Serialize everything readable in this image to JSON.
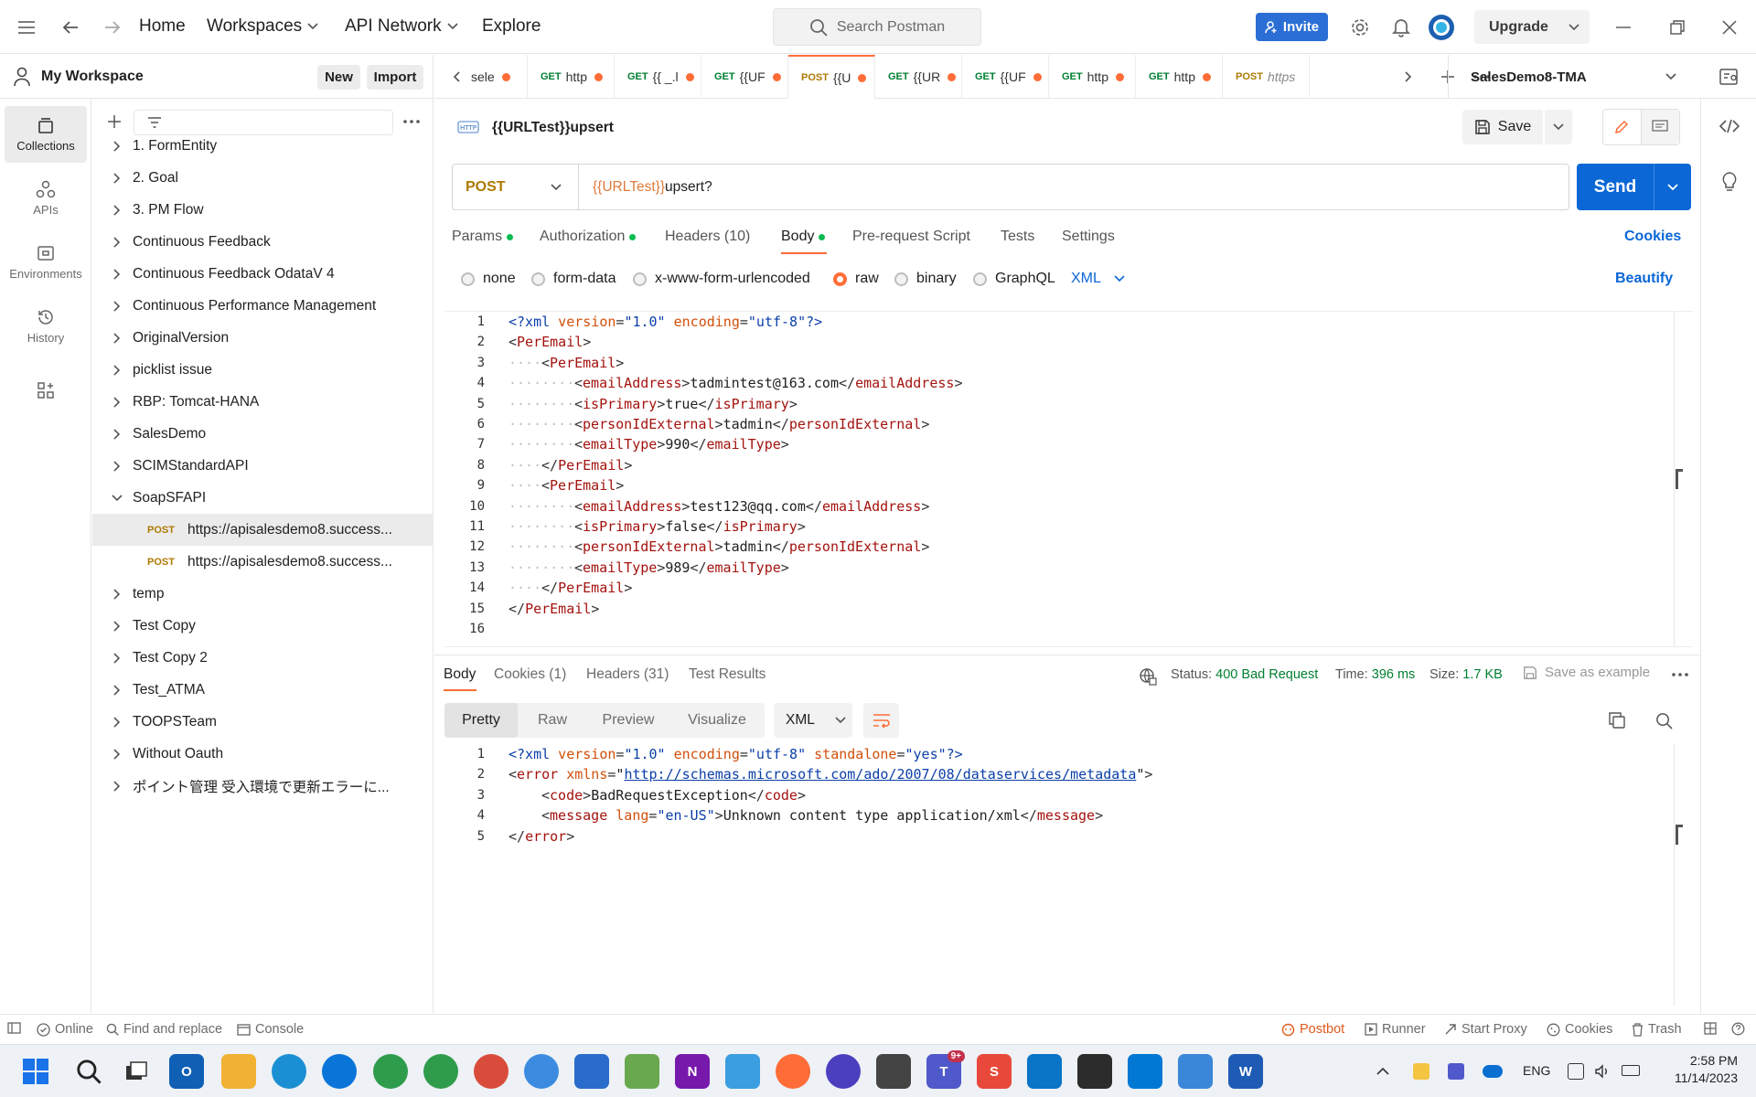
{
  "nav": {
    "home": "Home",
    "workspaces": "Workspaces",
    "api_network": "API Network",
    "explore": "Explore",
    "search_placeholder": "Search Postman",
    "invite": "Invite",
    "upgrade": "Upgrade"
  },
  "workspace": {
    "title": "My Workspace",
    "new_label": "New",
    "import_label": "Import"
  },
  "rail": [
    {
      "label": "Collections",
      "icon": "collections-icon"
    },
    {
      "label": "APIs",
      "icon": "apis-icon"
    },
    {
      "label": "Environments",
      "icon": "environments-icon"
    },
    {
      "label": "History",
      "icon": "history-icon"
    }
  ],
  "collections": [
    {
      "label": "1. FormEntity"
    },
    {
      "label": "2. Goal"
    },
    {
      "label": "3. PM Flow"
    },
    {
      "label": "Continuous Feedback"
    },
    {
      "label": "Continuous Feedback OdataV 4"
    },
    {
      "label": "Continuous Performance Management"
    },
    {
      "label": "OriginalVersion"
    },
    {
      "label": "picklist issue"
    },
    {
      "label": "RBP: Tomcat-HANA"
    },
    {
      "label": "SalesDemo"
    },
    {
      "label": "SCIMStandardAPI"
    },
    {
      "label": "SoapSFAPI",
      "expanded": true
    },
    {
      "label": "https://apisalesdemo8.success...",
      "method": "POST",
      "child": true,
      "selected": true
    },
    {
      "label": "https://apisalesdemo8.success...",
      "method": "POST",
      "child": true
    },
    {
      "label": "temp"
    },
    {
      "label": "Test Copy"
    },
    {
      "label": "Test Copy 2"
    },
    {
      "label": "Test_ATMA"
    },
    {
      "label": "TOOPSTeam"
    },
    {
      "label": "Without Oauth"
    },
    {
      "label": "ポイント管理 受入環境で更新エラーに..."
    }
  ],
  "tabs": [
    {
      "method": "",
      "label": "sele"
    },
    {
      "method": "GET",
      "label": "http"
    },
    {
      "method": "GET",
      "label": "{{ _.l"
    },
    {
      "method": "GET",
      "label": "{{UF"
    },
    {
      "method": "POST",
      "label": "{{U",
      "active": true
    },
    {
      "method": "GET",
      "label": "{{UR"
    },
    {
      "method": "GET",
      "label": "{{UF"
    },
    {
      "method": "GET",
      "label": "http"
    },
    {
      "method": "GET",
      "label": "http"
    },
    {
      "method": "POST",
      "label": "https",
      "italic": true
    }
  ],
  "environment": "SalesDemo8-TMA",
  "request": {
    "badge": "HTTP",
    "title": "{{URLTest}}upsert",
    "save_label": "Save",
    "method": "POST",
    "url_var": "{{URLTest}}",
    "url_rest": "upsert?",
    "send_label": "Send",
    "tabs": {
      "params": "Params",
      "authorization": "Authorization",
      "headers": "Headers (10)",
      "body": "Body",
      "prerequest": "Pre-request Script",
      "tests": "Tests",
      "settings": "Settings"
    },
    "cookies_label": "Cookies",
    "body_modes": {
      "none": "none",
      "form_data": "form-data",
      "urlencoded": "x-www-form-urlencoded",
      "raw": "raw",
      "binary": "binary",
      "graphql": "GraphQL"
    },
    "language": "XML",
    "beautify": "Beautify",
    "body_lines": [
      "<?xml version=\"1.0\" encoding=\"utf-8\"?>",
      "<PerEmail>",
      "<PerEmail>",
      "<emailAddress>tadmintest@163.com</emailAddress>",
      "<isPrimary>true</isPrimary>",
      "<personIdExternal>tadmin</personIdExternal>",
      "<emailType>990</emailType>",
      "</PerEmail>",
      "<PerEmail>",
      "<emailAddress>test123@qq.com</emailAddress>",
      "<isPrimary>false</isPrimary>",
      "<personIdExternal>tadmin</personIdExternal>",
      "<emailType>989</emailType>",
      "</PerEmail>",
      "</PerEmail>",
      ""
    ]
  },
  "response": {
    "tabs": {
      "body": "Body",
      "cookies": "Cookies (1)",
      "headers": "Headers (31)",
      "tests": "Test Results"
    },
    "status_label": "Status:",
    "status_value": "400 Bad Request",
    "time_label": "Time:",
    "time_value": "396 ms",
    "size_label": "Size:",
    "size_value": "1.7 KB",
    "save_example": "Save as example",
    "formats": {
      "pretty": "Pretty",
      "raw": "Raw",
      "preview": "Preview",
      "visualize": "Visualize"
    },
    "language": "XML",
    "body_lines": [
      "<?xml version=\"1.0\" encoding=\"utf-8\" standalone=\"yes\"?>",
      "<error xmlns=\"http://schemas.microsoft.com/ado/2007/08/dataservices/metadata\">",
      "<code>BadRequestException</code>",
      "<message lang=\"en-US\">Unknown content type application/xml</message>",
      "</error>"
    ]
  },
  "statusbar": {
    "online": "Online",
    "find_replace": "Find and replace",
    "console": "Console",
    "postbot": "Postbot",
    "runner": "Runner",
    "start_proxy": "Start Proxy",
    "cookies": "Cookies",
    "trash": "Trash"
  },
  "taskbar": {
    "lang": "ENG",
    "time": "2:58 PM",
    "date": "11/14/2023",
    "teams_badge": "9+"
  }
}
